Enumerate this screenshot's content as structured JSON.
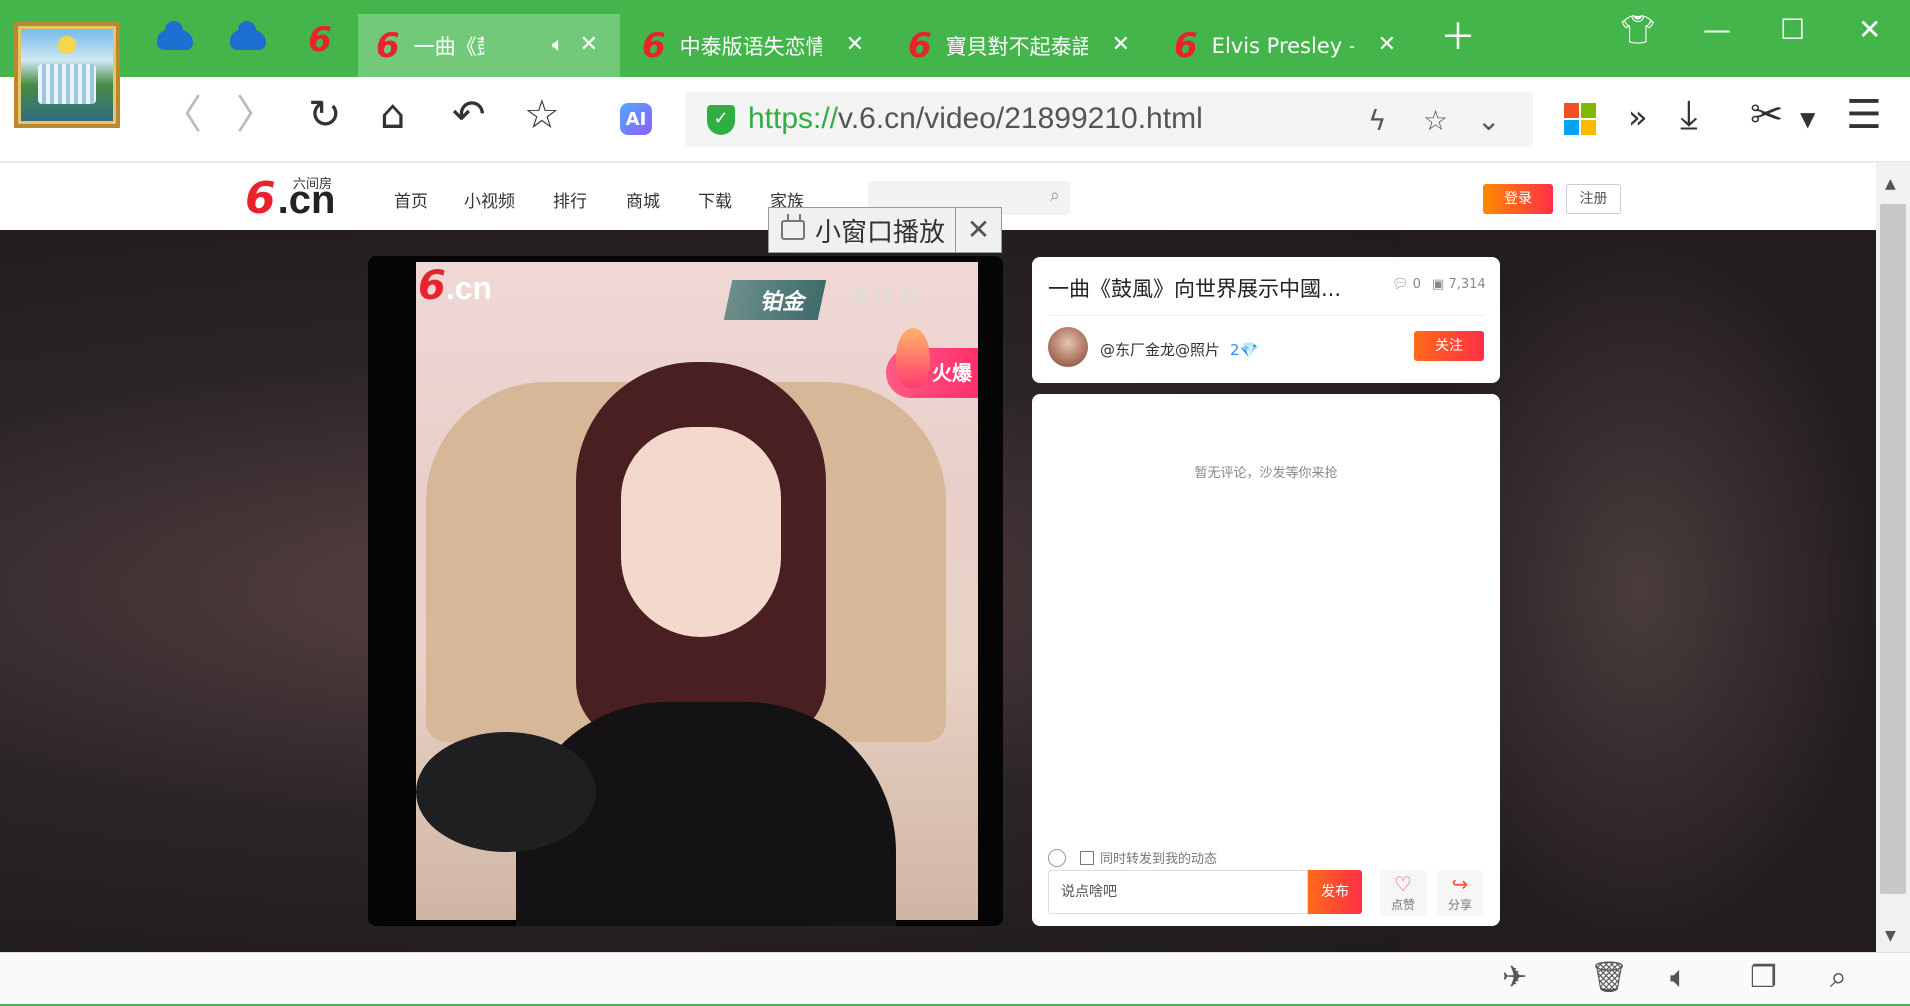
{
  "browser": {
    "tabs": [
      {
        "title": "一曲《鼓風》向世界展示中國",
        "active": true
      },
      {
        "title": "中泰版语失恋情歌",
        "active": false
      },
      {
        "title": "寶貝對不起泰語",
        "active": false
      },
      {
        "title": "Elvis Presley - ",
        "active": false
      }
    ],
    "pinned_tabs": [
      "onedrive-icon",
      "onedrive-icon",
      "six-cn-icon"
    ],
    "url_scheme": "https://",
    "url_rest": "v.6.cn/video/21899210.html",
    "ai_badge": "AI",
    "icons": [
      "back-icon",
      "forward-icon",
      "reload-icon",
      "home-icon",
      "undo-icon",
      "star-icon",
      "lightning-icon",
      "favorite-icon",
      "dropdown-icon",
      "apps-icon",
      "more-icon",
      "download-icon",
      "scissors-icon",
      "menu-icon"
    ]
  },
  "site": {
    "logo_sub": "六间房",
    "logo_cn": ".cn",
    "nav": [
      "首页",
      "小视频",
      "排行",
      "商城",
      "下载",
      "家族"
    ],
    "login": "登录",
    "register": "注册"
  },
  "mini_player": {
    "label": "小窗口播放"
  },
  "video": {
    "watermark": ".cn",
    "badge_platinum": "铂金",
    "badge_hot": "火爆"
  },
  "info": {
    "title": "一曲《鼓風》向世界展示中國...",
    "comments": "0",
    "views": "7,314",
    "author": "@东厂金龙@照片",
    "level": "2💎",
    "follow": "关注"
  },
  "comments": {
    "empty": "暂无评论，沙发等你来抢",
    "repost": "同时转发到我的动态",
    "placeholder": "说点啥吧",
    "send": "发布",
    "like": "点赞",
    "share": "分享"
  }
}
